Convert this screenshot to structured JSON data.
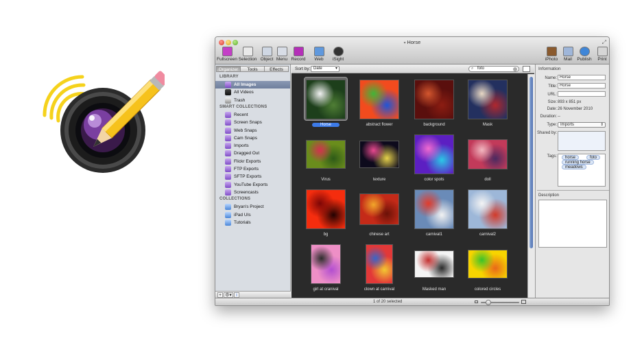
{
  "window": {
    "title": "Horse"
  },
  "toolbar": {
    "left": [
      {
        "label": "Fullscreen",
        "icon": "fullscreen-icon",
        "color": "#c43fc7"
      },
      {
        "label": "Selection",
        "icon": "selection-icon",
        "color": "#e9e9e9"
      },
      {
        "label": "Object",
        "icon": "object-icon",
        "color": "#cfd7e3"
      },
      {
        "label": "Menu",
        "icon": "menu-icon",
        "color": "#d8dde6"
      },
      {
        "label": "Record",
        "icon": "record-icon",
        "color": "#b42fb8"
      },
      {
        "label": "Web",
        "icon": "web-icon",
        "color": "#5f98dd"
      },
      {
        "label": "iSight",
        "icon": "isight-icon",
        "color": "#333333"
      }
    ],
    "right": [
      {
        "label": "iPhoto",
        "icon": "iphoto-icon",
        "color": "#8a5a2e"
      },
      {
        "label": "Mail",
        "icon": "mail-icon",
        "color": "#9fb6d9"
      },
      {
        "label": "Publish",
        "icon": "publish-icon",
        "color": "#3f86d8"
      },
      {
        "label": "Print",
        "icon": "print-icon",
        "color": "#d6d6d6"
      }
    ]
  },
  "sidebar": {
    "tabs": [
      "Organizer",
      "Tools",
      "Effects"
    ],
    "active_tab": 0,
    "sections": {
      "library": "LIBRARY",
      "smart": "SMART COLLECTIONS",
      "collections": "COLLECTIONS"
    },
    "library": [
      {
        "label": "All Images",
        "icon": "all-images-icon",
        "selected": true
      },
      {
        "label": "All Videos",
        "icon": "film-icon"
      },
      {
        "label": "Trash",
        "icon": "trash-icon"
      }
    ],
    "smart": [
      "Recent",
      "Screen Snaps",
      "Web Snaps",
      "Cam Snaps",
      "Imports",
      "Dragged Out",
      "Flickr Exports",
      "FTP Exports",
      "SFTP Exports",
      "YouTube Exports",
      "Screencasts"
    ],
    "collections": [
      "Bryan's Project",
      "iPad UIs",
      "Tutorials"
    ],
    "bottom_buttons": [
      "+",
      "⚙▾",
      "i"
    ]
  },
  "browser": {
    "sort_label": "Sort by:",
    "sort_value": "Date",
    "search_value": "foto",
    "selected_index": 0,
    "images": [
      {
        "name": "Horse",
        "colors": [
          "#1d3f1b",
          "#f2f2f2",
          "#4f7e35"
        ]
      },
      {
        "name": "abstract flower",
        "colors": [
          "#f24b1e",
          "#3fb53a",
          "#1f55d6"
        ]
      },
      {
        "name": "background",
        "colors": [
          "#5a0f0d",
          "#d4562e",
          "#8c1d12"
        ]
      },
      {
        "name": "Mask",
        "colors": [
          "#23305f",
          "#e9d8c4",
          "#b0282e"
        ]
      },
      {
        "name": "Virus",
        "colors": [
          "#6a8d1c",
          "#d3304f",
          "#2e5a18"
        ]
      },
      {
        "name": "texture",
        "colors": [
          "#0d0a1c",
          "#e94a8f",
          "#e6d14b"
        ]
      },
      {
        "name": "color spots",
        "colors": [
          "#5c1fc2",
          "#f06bd1",
          "#2bc8e6"
        ]
      },
      {
        "name": "doll",
        "colors": [
          "#c23a5a",
          "#f1b7c0",
          "#4a2a60"
        ]
      },
      {
        "name": "bg",
        "colors": [
          "#f52d0e",
          "#7b0606",
          "#220202"
        ]
      },
      {
        "name": "chinese art",
        "colors": [
          "#c42a18",
          "#f1a62a",
          "#6b1208"
        ]
      },
      {
        "name": "carnival1",
        "colors": [
          "#6a8bb8",
          "#e23c2c",
          "#f2f2f2"
        ]
      },
      {
        "name": "carnival2",
        "colors": [
          "#9db7d8",
          "#f3f3f3",
          "#d23a2a"
        ]
      },
      {
        "name": "girl at cranival",
        "colors": [
          "#ee8fc6",
          "#2c2c2c",
          "#b24ed0"
        ]
      },
      {
        "name": "clown at carnival",
        "colors": [
          "#e23838",
          "#3a66c8",
          "#f2c832"
        ]
      },
      {
        "name": "Masked man",
        "colors": [
          "#f4f4f4",
          "#c43030",
          "#2a2a2a"
        ]
      },
      {
        "name": "colored circles",
        "colors": [
          "#f7d400",
          "#3ac22a",
          "#e8681a"
        ]
      }
    ]
  },
  "info": {
    "heading": "Information",
    "name_label": "Name:",
    "name": "Horse",
    "title_label": "Title:",
    "title": "Horse",
    "url_label": "URL:",
    "url": "",
    "size_label": "Size:",
    "size": "893 x 851 px",
    "date_label": "Date:",
    "date": "26 November 2010",
    "duration_label": "Duration:",
    "duration": "--",
    "type_label": "Type:",
    "type": "Imports",
    "shared_label": "Shared by:",
    "tags_label": "Tags:",
    "tags": [
      "horse",
      "foto",
      "running horse",
      "meadows"
    ],
    "description_label": "Description"
  },
  "status": {
    "text": "1 of 20 selected",
    "zoom_level": 0.2
  }
}
